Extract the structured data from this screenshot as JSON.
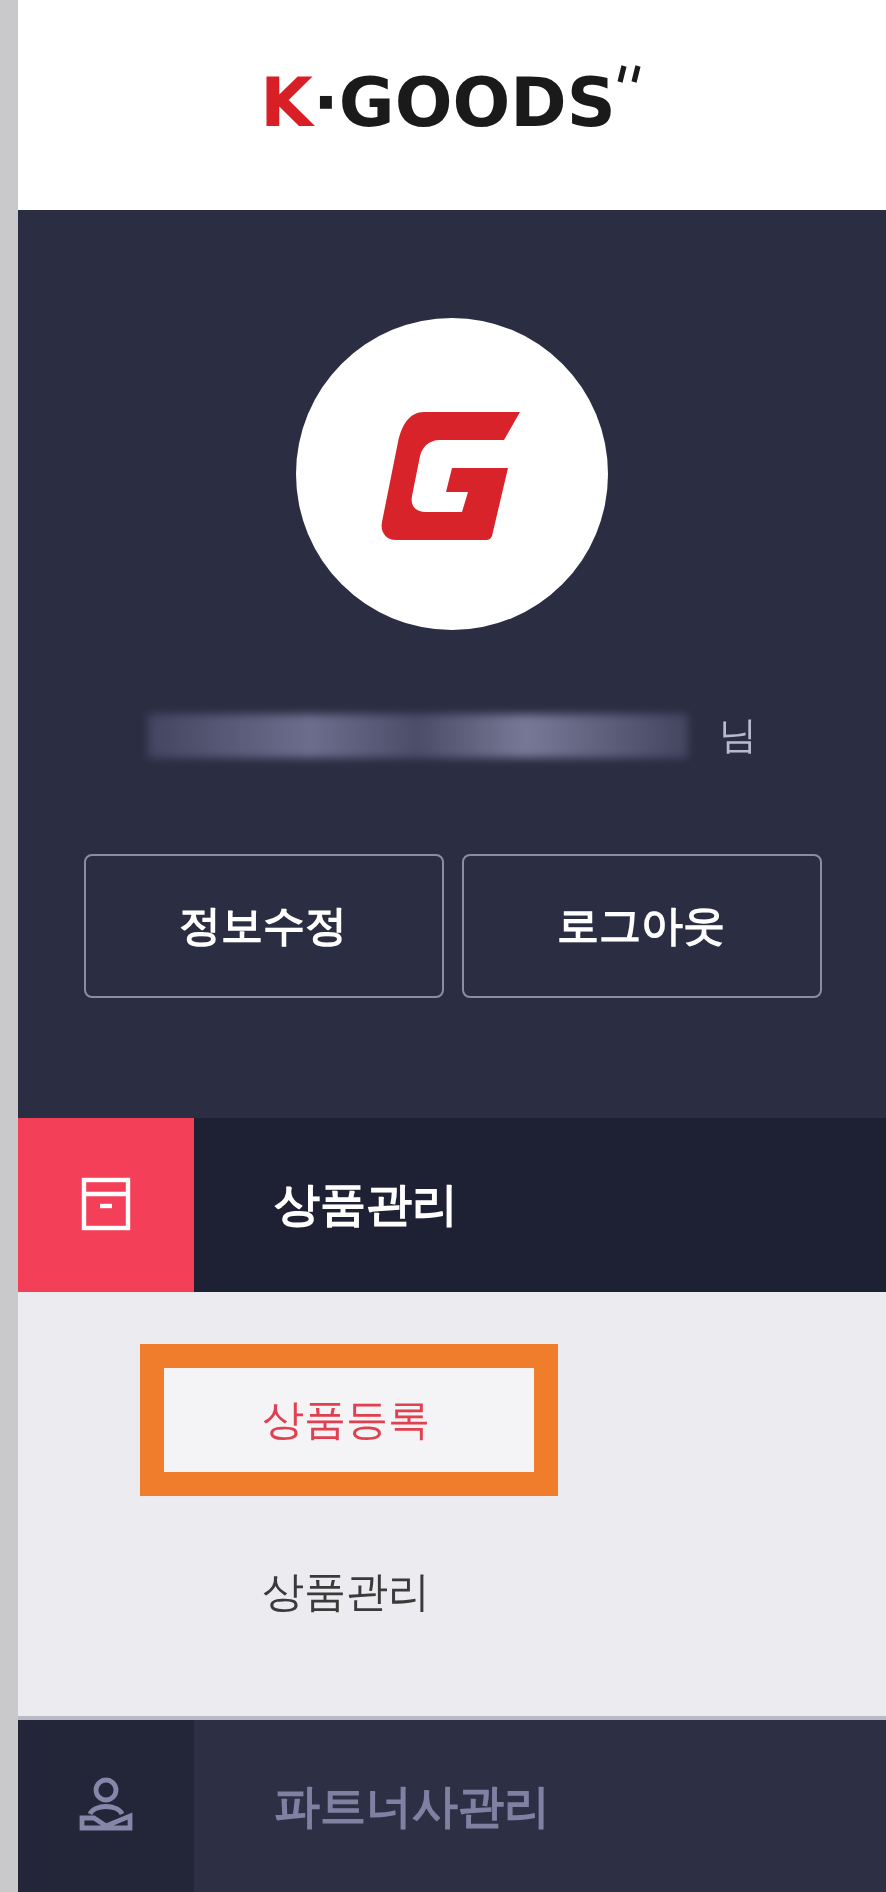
{
  "logo": {
    "accent": "K",
    "rest": "·GOODS"
  },
  "profile": {
    "suffix": "님"
  },
  "buttons": [
    "정보수정",
    "로그아웃"
  ],
  "menu": [
    {
      "label": "상품관리",
      "kind": "products",
      "expanded": true,
      "children": [
        {
          "label": "상품등록",
          "selected": true,
          "highlighted": true
        },
        {
          "label": "상품관리",
          "selected": false,
          "highlighted": false
        }
      ]
    },
    {
      "label": "파트너사관리",
      "kind": "partners",
      "expanded": false
    }
  ]
}
